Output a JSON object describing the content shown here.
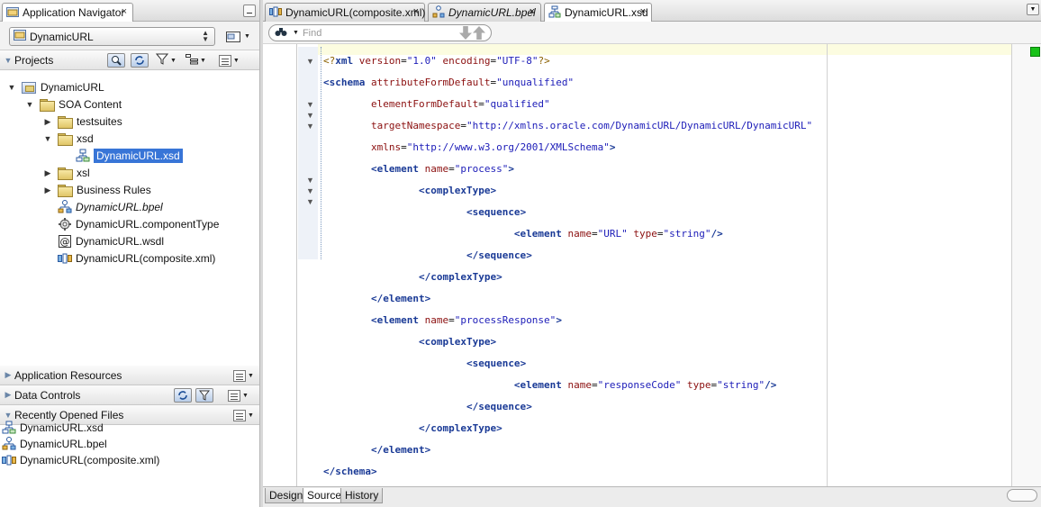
{
  "navigator": {
    "tab_title": "Application Navigator",
    "close_glyph": "×",
    "app_name": "DynamicURL",
    "projects_label": "Projects",
    "tree": [
      {
        "label": "DynamicURL",
        "kind": "project",
        "level": 0,
        "expanded": true
      },
      {
        "label": "SOA Content",
        "kind": "folder",
        "level": 1,
        "expanded": true
      },
      {
        "label": "testsuites",
        "kind": "folder",
        "level": 2,
        "expanded": false
      },
      {
        "label": "xsd",
        "kind": "folder",
        "level": 2,
        "expanded": true
      },
      {
        "label": "DynamicURL.xsd",
        "kind": "xsd-file",
        "level": 3,
        "selected": true
      },
      {
        "label": "xsl",
        "kind": "folder",
        "level": 2,
        "expanded": false
      },
      {
        "label": "Business Rules",
        "kind": "folder",
        "level": 2,
        "expanded": false
      },
      {
        "label": "DynamicURL.bpel",
        "kind": "bpel-file",
        "level": 2,
        "italic": true
      },
      {
        "label": "DynamicURL.componentType",
        "kind": "component-file",
        "level": 2
      },
      {
        "label": "DynamicURL.wsdl",
        "kind": "wsdl-file",
        "level": 2
      },
      {
        "label": "DynamicURL(composite.xml)",
        "kind": "composite-file",
        "level": 2
      }
    ],
    "sections": {
      "application_resources": "Application Resources",
      "data_controls": "Data Controls",
      "recently_opened": "Recently Opened Files"
    },
    "recent_files": [
      "DynamicURL.xsd",
      "DynamicURL.bpel",
      "DynamicURL(composite.xml)"
    ]
  },
  "editor": {
    "tabs": [
      {
        "label": "DynamicURL(composite.xml)",
        "italic": false
      },
      {
        "label": "DynamicURL.bpel",
        "italic": true
      },
      {
        "label": "DynamicURL.xsd",
        "italic": false,
        "active": true
      }
    ],
    "close_glyph": "×",
    "find_placeholder": "Find",
    "code": {
      "l1": [
        "<?",
        "xml",
        " version",
        "=",
        "\"1.0\"",
        " encoding",
        "=",
        "\"UTF-8\"",
        "?>"
      ],
      "schema_open": "schema",
      "attr_efd": "attributeFormDefault",
      "attr_efd_val": "\"unqualified\"",
      "el_fd": "elementFormDefault",
      "el_fd_val": "\"qualified\"",
      "tns": "targetNamespace",
      "tns_val": "\"http://xmlns.oracle.com/DynamicURL/DynamicURL/DynamicURL\"",
      "xmlns": "xmlns",
      "xmlns_val": "\"http://www.w3.org/2001/XMLSchema\"",
      "element": "element",
      "name": "name",
      "type": "type",
      "process_val": "\"process\"",
      "complexType": "complexType",
      "sequence": "sequence",
      "url_val": "\"URL\"",
      "string_val": "\"string\"",
      "processResponse_val": "\"processResponse\"",
      "responseCode_val": "\"responseCode\""
    },
    "bottom_tabs": [
      "Design",
      "Source",
      "History"
    ],
    "active_bottom_tab": "Source"
  }
}
